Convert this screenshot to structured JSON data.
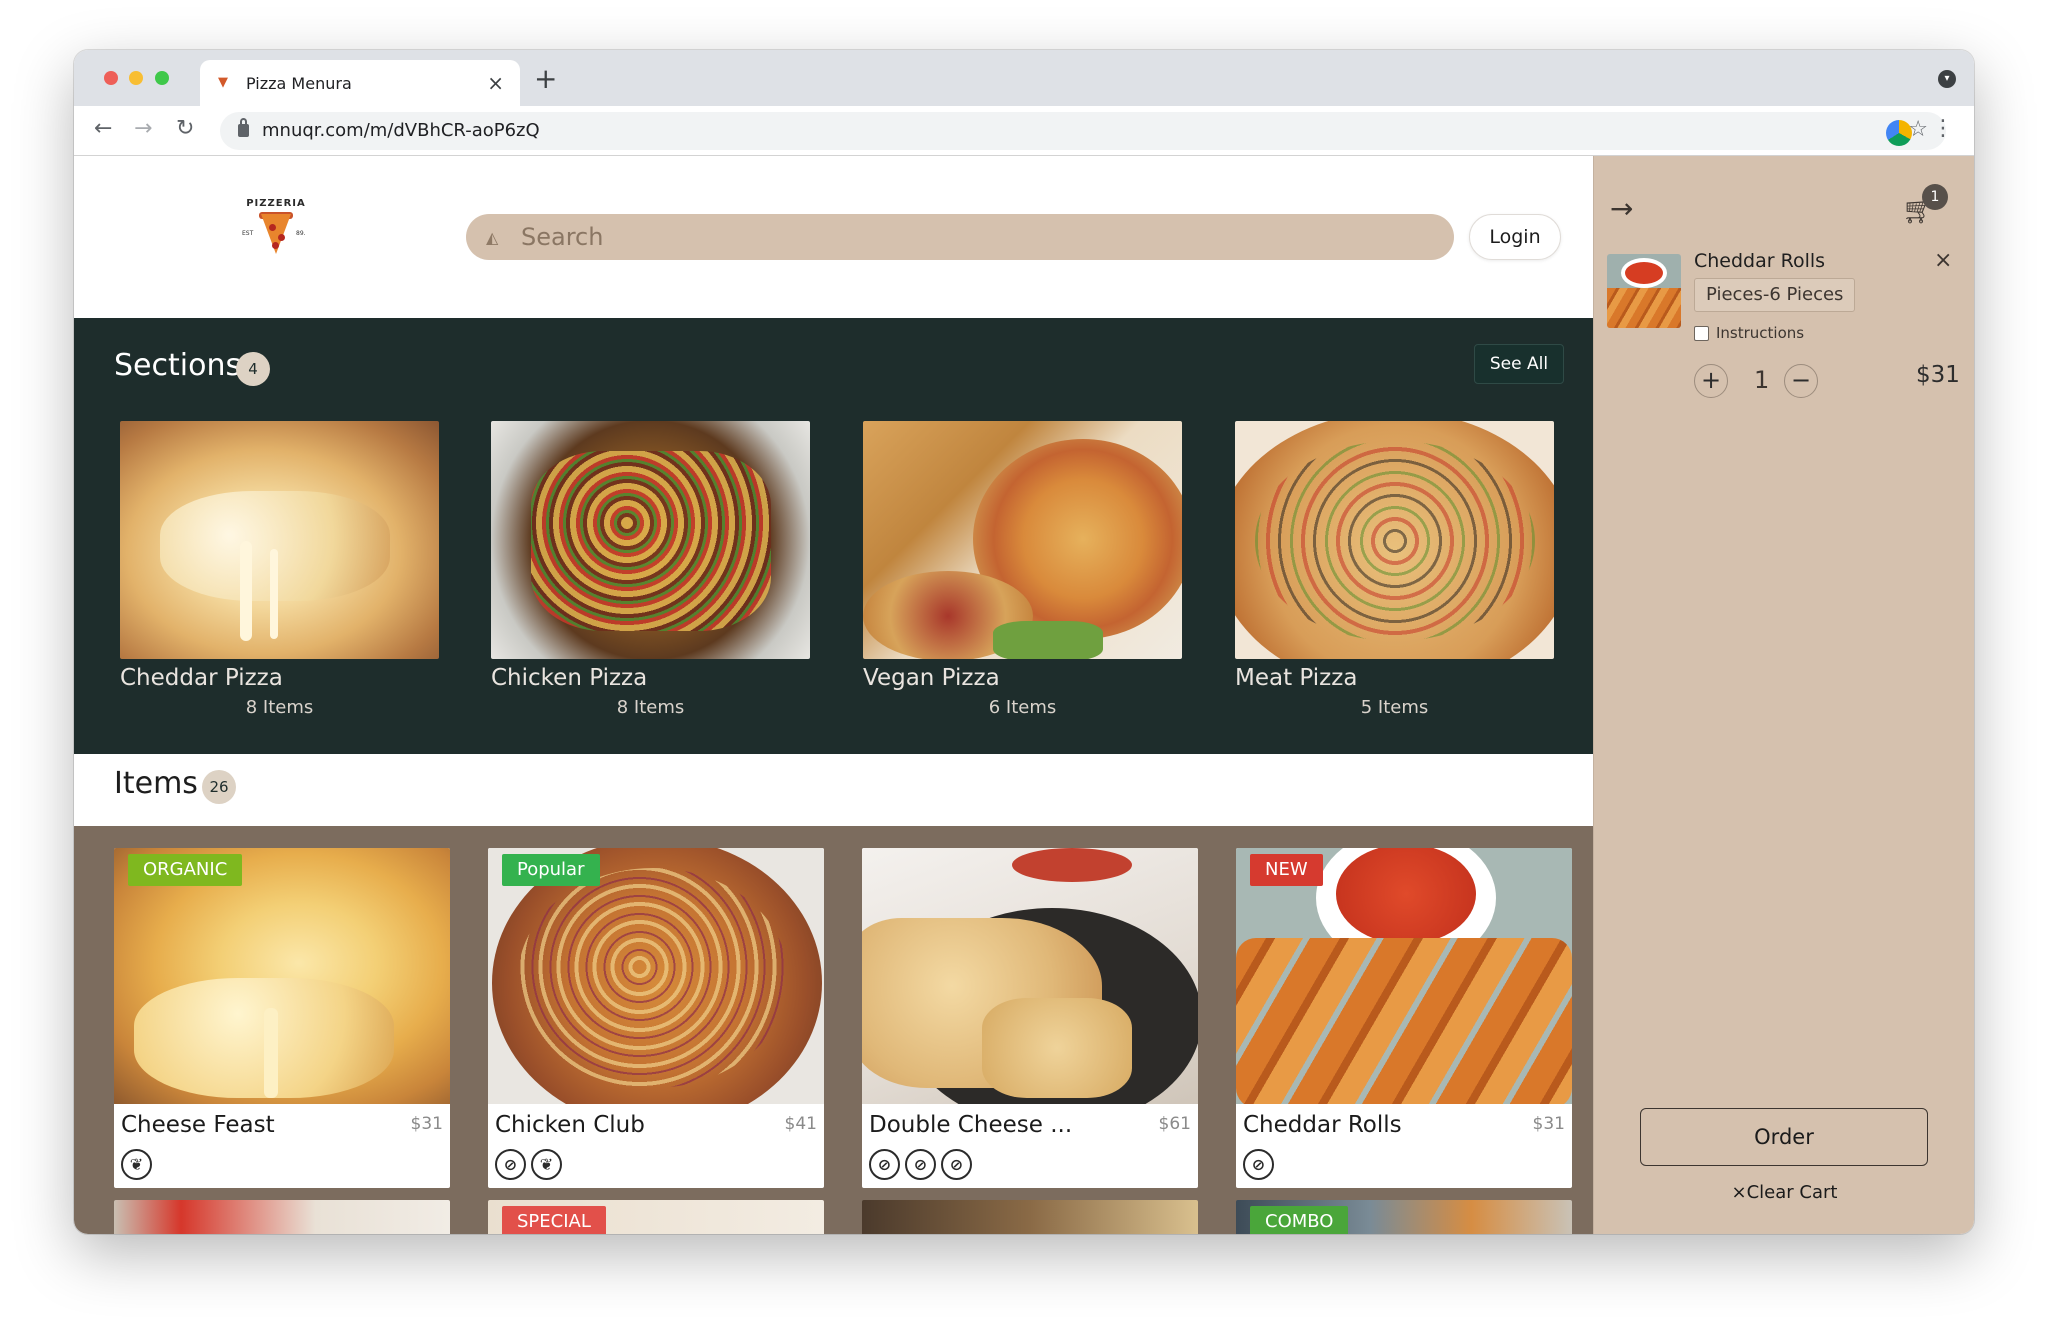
{
  "browser": {
    "tab_title": "Pizza Menura",
    "url": "mnuqr.com/m/dVBhCR-aoP6zQ",
    "new_tab_symbol": "+",
    "tab_close_symbol": "×"
  },
  "header": {
    "logo_text": "PIZZERIA",
    "logo_left": "EST",
    "logo_right": "89.",
    "search_placeholder": "Search",
    "login_label": "Login"
  },
  "sections": {
    "title": "Sections",
    "count": "4",
    "see_all_label": "See All",
    "cards": [
      {
        "name": "Cheddar Pizza",
        "count": "8 Items"
      },
      {
        "name": "Chicken Pizza",
        "count": "8 Items"
      },
      {
        "name": "Vegan Pizza",
        "count": "6 Items"
      },
      {
        "name": "Meat Pizza",
        "count": "5 Items"
      }
    ]
  },
  "items": {
    "title": "Items",
    "count": "26",
    "cards": [
      {
        "name": "Cheese Feast",
        "price": "$31",
        "tag": "ORGANIC",
        "tag_color": "#7fb81f",
        "diet_icons": [
          "vegetarian-icon"
        ]
      },
      {
        "name": "Chicken Club",
        "price": "$41",
        "tag": "Popular",
        "tag_color": "#34b24e",
        "diet_icons": [
          "no-gluten-icon",
          "vegetarian-icon"
        ]
      },
      {
        "name": "Double Cheese ...",
        "price": "$61",
        "tag": "",
        "tag_color": "",
        "diet_icons": [
          "no-dairy-icon",
          "no-wheat-icon",
          "no-egg-icon"
        ]
      },
      {
        "name": "Cheddar Rolls",
        "price": "$31",
        "tag": "NEW",
        "tag_color": "#d63a2f",
        "diet_icons": [
          "no-dairy-icon"
        ]
      }
    ],
    "bottom_tags": [
      {
        "tag": "",
        "tag_color": ""
      },
      {
        "tag": "SPECIAL",
        "tag_color": "#e2504a"
      },
      {
        "tag": "",
        "tag_color": ""
      },
      {
        "tag": "COMBO",
        "tag_color": "#4aa63a"
      }
    ]
  },
  "cart": {
    "badge_count": "1",
    "item_name": "Cheddar Rolls",
    "option": "Pieces-6 Pieces",
    "instructions_label": "Instructions",
    "quantity": "1",
    "price": "$31",
    "order_label": "Order",
    "clear_label": "Clear Cart",
    "plus": "+",
    "minus": "−",
    "remove_symbol": "×",
    "clear_symbol": "×"
  },
  "colors": {
    "sections_bg": "#1e2d2c",
    "items_bg": "#7c6c5e",
    "cart_bg": "#d5c1ae",
    "search_bg": "#d5c1ae"
  }
}
